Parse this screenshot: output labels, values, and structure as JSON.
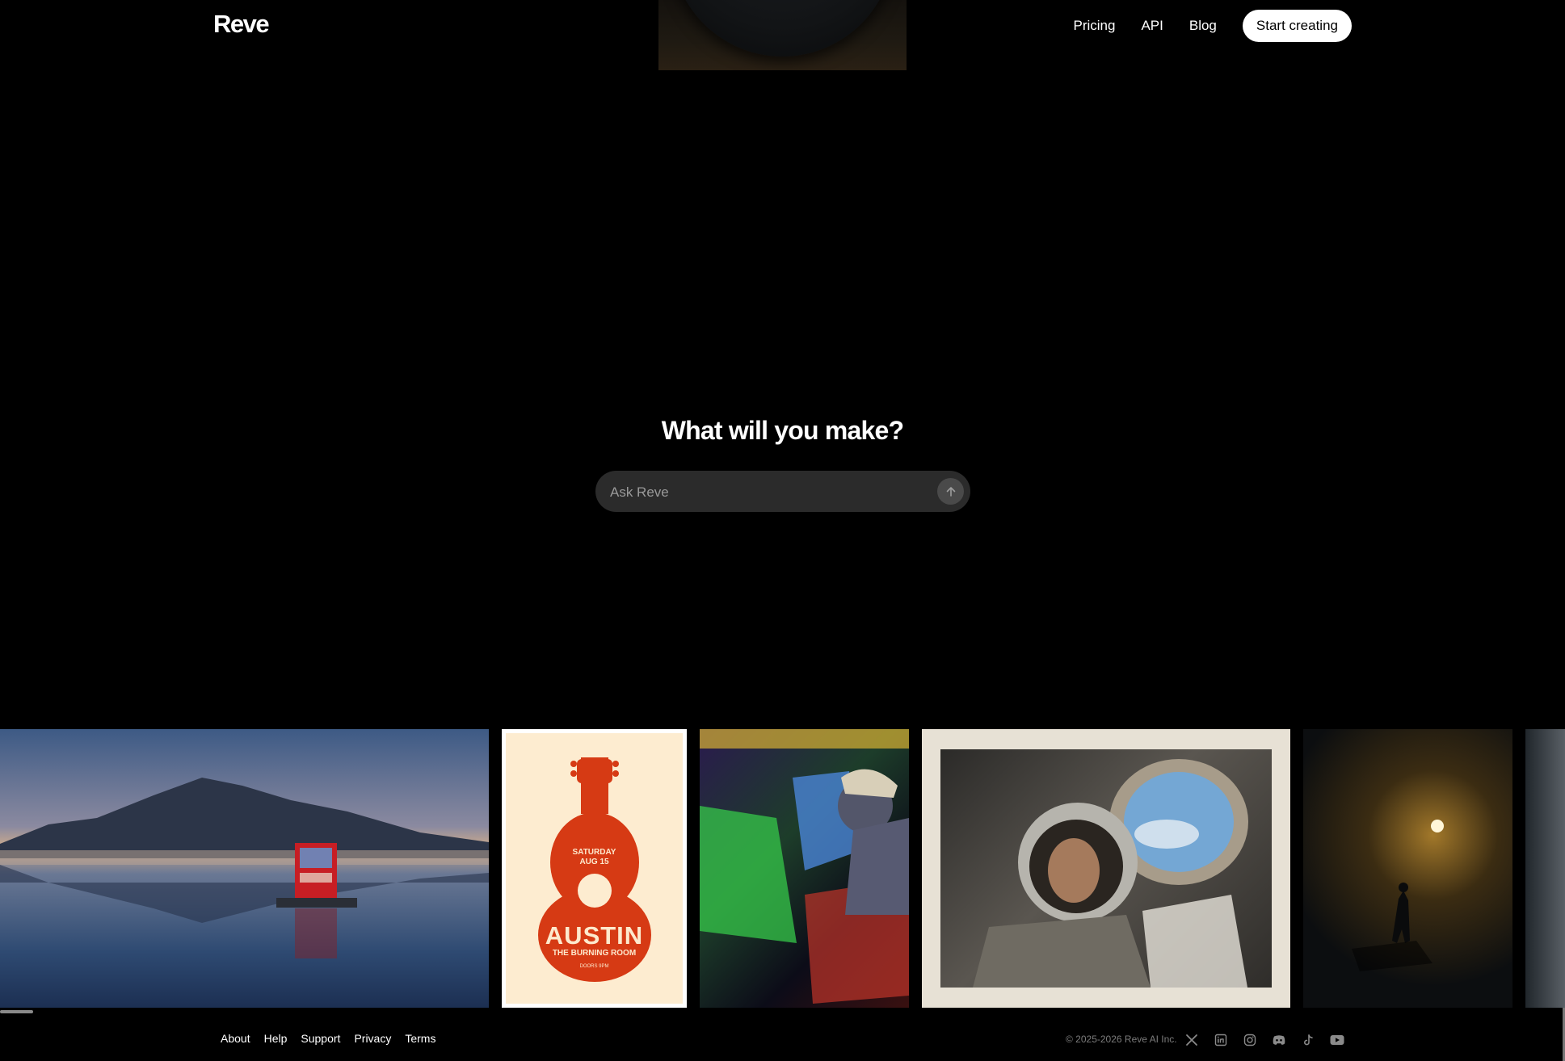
{
  "header": {
    "logo": "Reve",
    "nav": [
      {
        "label": "Pricing"
      },
      {
        "label": "API"
      },
      {
        "label": "Blog"
      }
    ],
    "cta_label": "Start creating"
  },
  "hero": {
    "title": "What will you make?",
    "prompt": {
      "placeholder": "Ask Reve",
      "value": "",
      "send_icon": "arrow-up-icon"
    }
  },
  "gallery": {
    "items": [
      {
        "name": "lake-vending-machine-image"
      },
      {
        "name": "austin-guitar-poster-image",
        "poster_lines": [
          "SATURDAY",
          "AUG 15",
          "AUSTIN",
          "THE BURNING ROOM",
          "DOORS 9PM"
        ]
      },
      {
        "name": "arcade-player-image"
      },
      {
        "name": "astronaut-porthole-image"
      },
      {
        "name": "foggy-figure-light-image"
      },
      {
        "name": "partial-gallery-image"
      }
    ]
  },
  "footer": {
    "links": [
      "About",
      "Help",
      "Support",
      "Privacy",
      "Terms"
    ],
    "copyright": "© 2025-2026 Reve AI Inc.",
    "socials": [
      "x-icon",
      "linkedin-icon",
      "instagram-icon",
      "discord-icon",
      "tiktok-icon",
      "youtube-icon"
    ]
  },
  "colors": {
    "background": "#000000",
    "text": "#ffffff",
    "input_bg": "#2b2b2b",
    "muted": "#7b7b7b",
    "poster_red": "#d63a14",
    "poster_cream": "#fdecd0"
  }
}
